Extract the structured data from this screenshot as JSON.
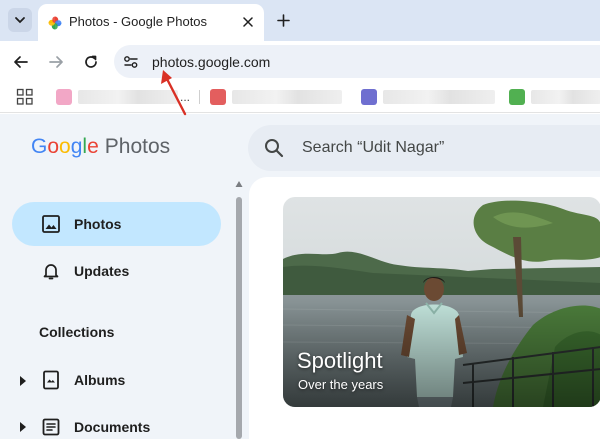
{
  "browser": {
    "tab": {
      "title": "Photos - Google Photos"
    },
    "address": {
      "url": "photos.google.com"
    },
    "bookmarks": [
      {
        "label": "",
        "color": "#f2a7c6"
      },
      {
        "label": "...",
        "color": "#e35e5e"
      },
      {
        "label": "",
        "color": "#6f6fd0"
      },
      {
        "label": "",
        "color": "#51b051"
      }
    ]
  },
  "app": {
    "logo": {
      "google": [
        "G",
        "o",
        "o",
        "g",
        "l",
        "e"
      ],
      "product": "Photos"
    },
    "search": {
      "placeholder": "Search “Udit Nagar”"
    }
  },
  "sidebar": {
    "items": [
      {
        "label": "Photos",
        "icon": "photo-icon",
        "active": true
      },
      {
        "label": "Updates",
        "icon": "bell-icon",
        "active": false
      }
    ],
    "collections_heading": "Collections",
    "collections": [
      {
        "label": "Albums",
        "icon": "album-icon"
      },
      {
        "label": "Documents",
        "icon": "document-icon"
      }
    ]
  },
  "main": {
    "card": {
      "title": "Spotlight",
      "subtitle": "Over the years"
    }
  },
  "colors": {
    "active_nav": "#c2e7ff",
    "annotation_arrow": "#d93025",
    "page_bg": "#f0f4f9"
  }
}
